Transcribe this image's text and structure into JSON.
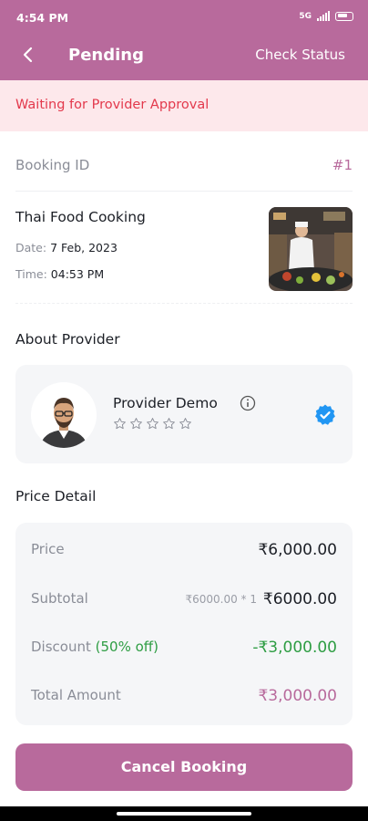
{
  "status_bar": {
    "time": "4:54 PM",
    "network": "5G"
  },
  "app_bar": {
    "title": "Pending",
    "action": "Check Status",
    "accent": "#b86a9c"
  },
  "banner": {
    "text": "Waiting for Provider Approval",
    "color": "#e3394c"
  },
  "booking": {
    "id_label": "Booking ID",
    "id_value": "#1",
    "service_name": "Thai Food Cooking",
    "date_label": "Date:",
    "date_value": "7 Feb, 2023",
    "time_label": "Time:",
    "time_value": "04:53 PM"
  },
  "provider": {
    "section_title": "About Provider",
    "name": "Provider Demo",
    "rating": 0,
    "max_rating": 5
  },
  "price_detail": {
    "section_title": "Price Detail",
    "price_label": "Price",
    "price_value": "₹6,000.00",
    "subtotal_label": "Subtotal",
    "subtotal_note": "₹6000.00 * 1",
    "subtotal_value": "₹6000.00",
    "discount_label": "Discount",
    "discount_off": "(50% off)",
    "discount_value": "-₹3,000.00",
    "total_label": "Total Amount",
    "total_value": "₹3,000.00"
  },
  "actions": {
    "cancel": "Cancel Booking"
  }
}
